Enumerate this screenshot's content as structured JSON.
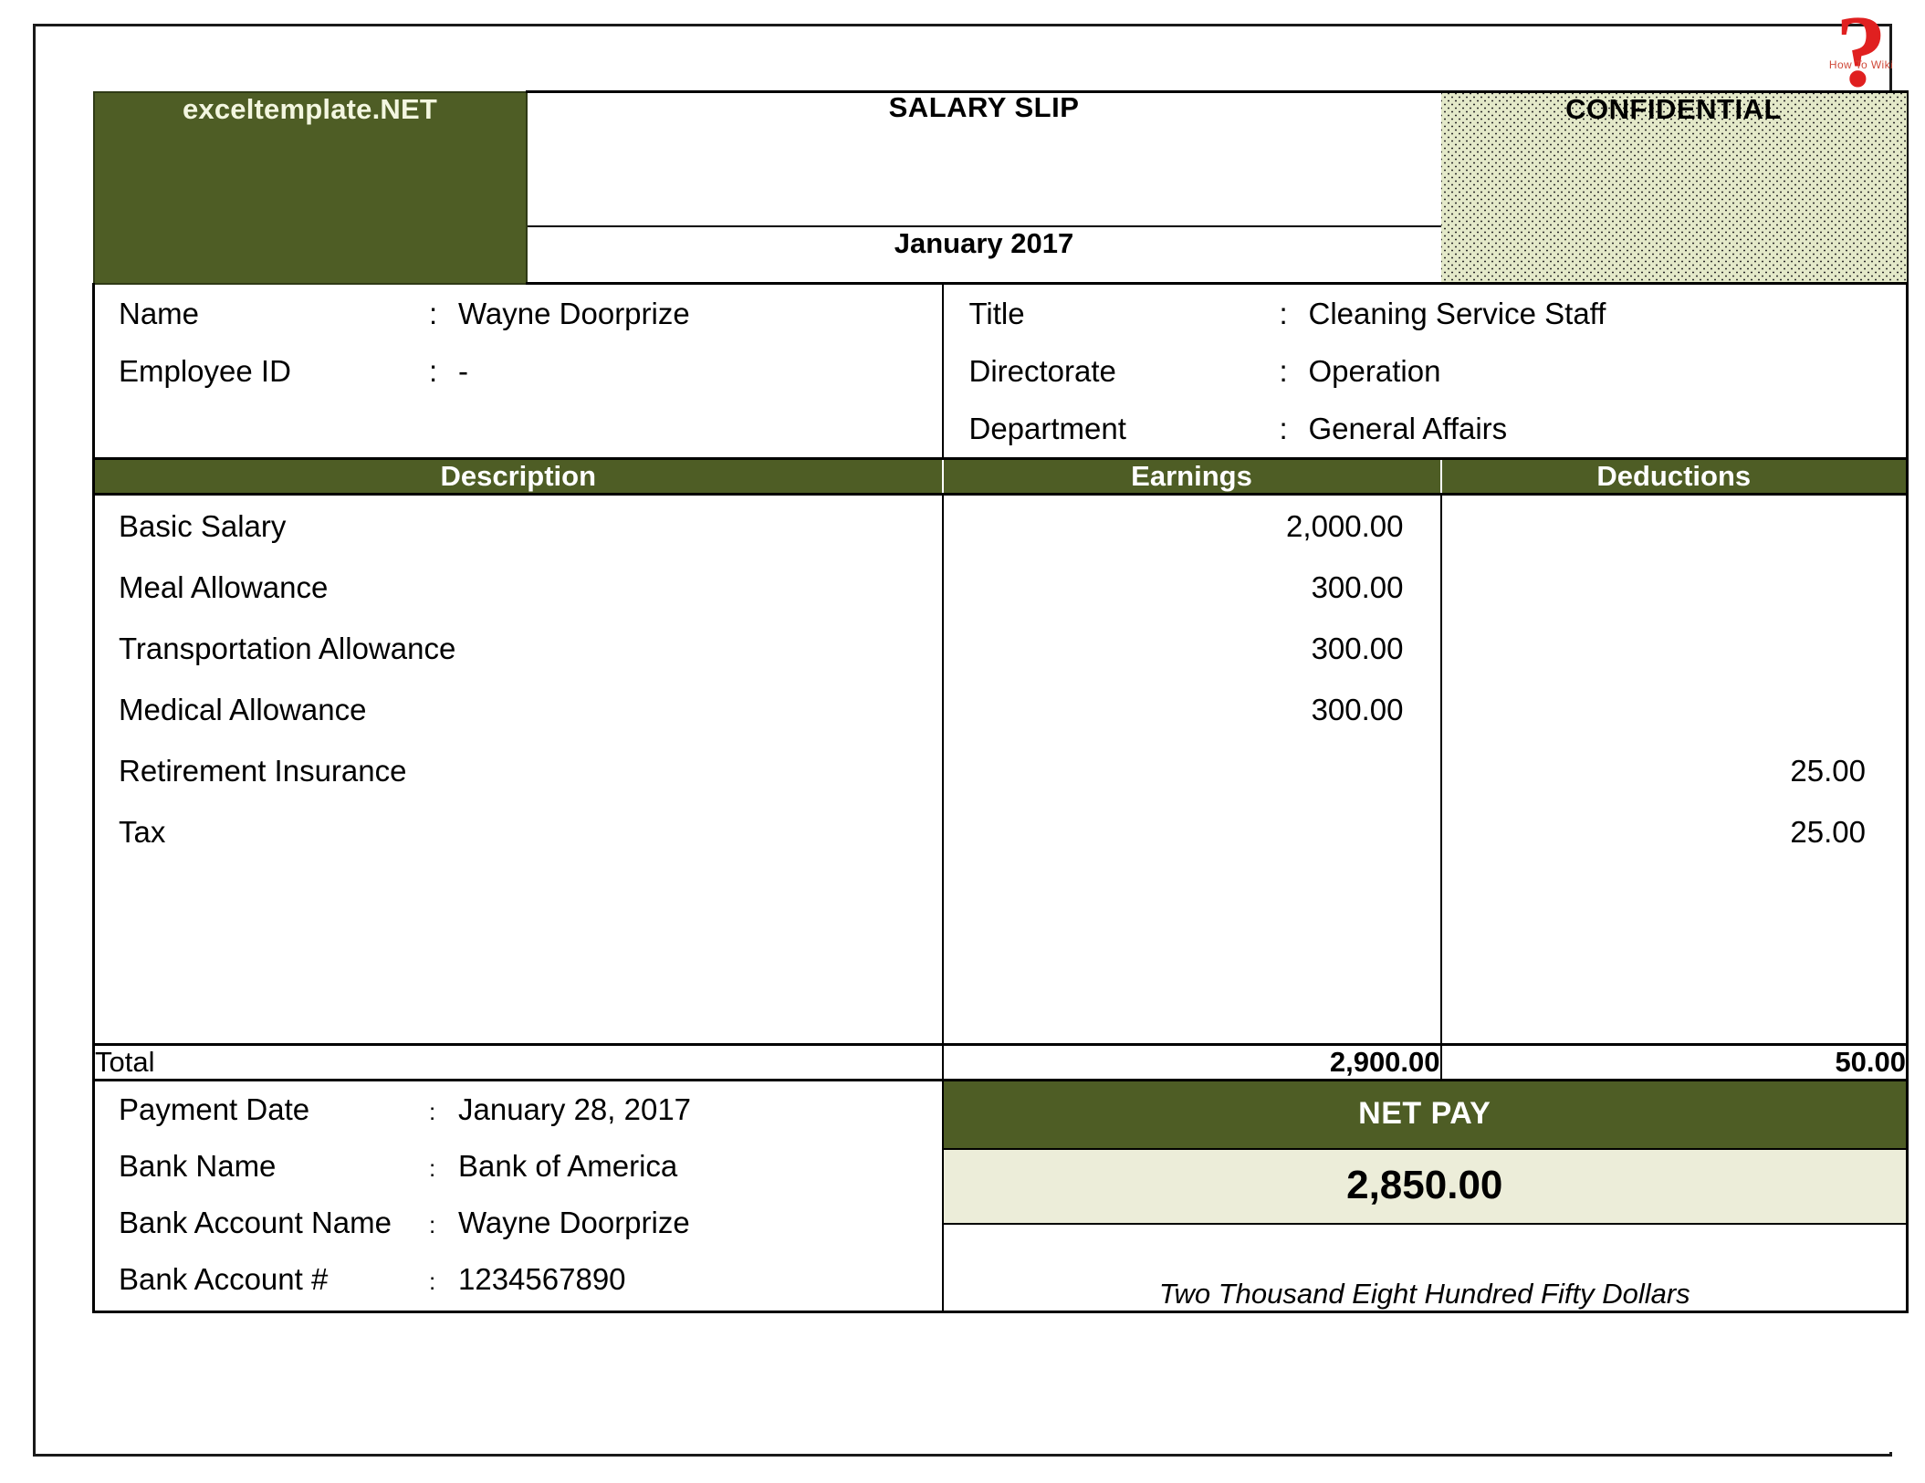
{
  "header": {
    "logo": "exceltemplate.NET",
    "title": "SALARY SLIP",
    "period": "January 2017",
    "confidential": "CONFIDENTIAL",
    "colors": {
      "green": "#4e5d25",
      "confidential_bg": "#e4e9c9",
      "netpay_bg": "#ecedd9"
    }
  },
  "watermark": {
    "mark": "?",
    "text": "How To Wiki"
  },
  "employee_left": [
    {
      "label": "Name",
      "colon": ":",
      "value": "Wayne Doorprize"
    },
    {
      "label": "Employee ID",
      "colon": ":",
      "value": "-"
    }
  ],
  "employee_right": [
    {
      "label": "Title",
      "colon": ":",
      "value": "Cleaning Service Staff"
    },
    {
      "label": "Directorate",
      "colon": ":",
      "value": "Operation"
    },
    {
      "label": "Department",
      "colon": ":",
      "value": "General Affairs"
    }
  ],
  "table": {
    "columns": [
      "Description",
      "Earnings",
      "Deductions"
    ],
    "rows": [
      {
        "description": "Basic Salary",
        "earnings": "2,000.00",
        "deductions": ""
      },
      {
        "description": "Meal Allowance",
        "earnings": "300.00",
        "deductions": ""
      },
      {
        "description": "Transportation Allowance",
        "earnings": "300.00",
        "deductions": ""
      },
      {
        "description": "Medical Allowance",
        "earnings": "300.00",
        "deductions": ""
      },
      {
        "description": "Retirement Insurance",
        "earnings": "",
        "deductions": "25.00"
      },
      {
        "description": "Tax",
        "earnings": "",
        "deductions": "25.00"
      }
    ],
    "total": {
      "label": "Total",
      "earnings": "2,900.00",
      "deductions": "50.00"
    }
  },
  "payment": [
    {
      "label": "Payment Date",
      "colon": ":",
      "value": "January 28, 2017"
    },
    {
      "label": "Bank Name",
      "colon": ":",
      "value": "Bank of America"
    },
    {
      "label": "Bank Account Name",
      "colon": ":",
      "value": "Wayne Doorprize"
    },
    {
      "label": "Bank Account #",
      "colon": ":",
      "value": "1234567890"
    }
  ],
  "netpay": {
    "title": "NET PAY",
    "amount": "2,850.00",
    "words": "Two Thousand Eight Hundred Fifty Dollars"
  }
}
